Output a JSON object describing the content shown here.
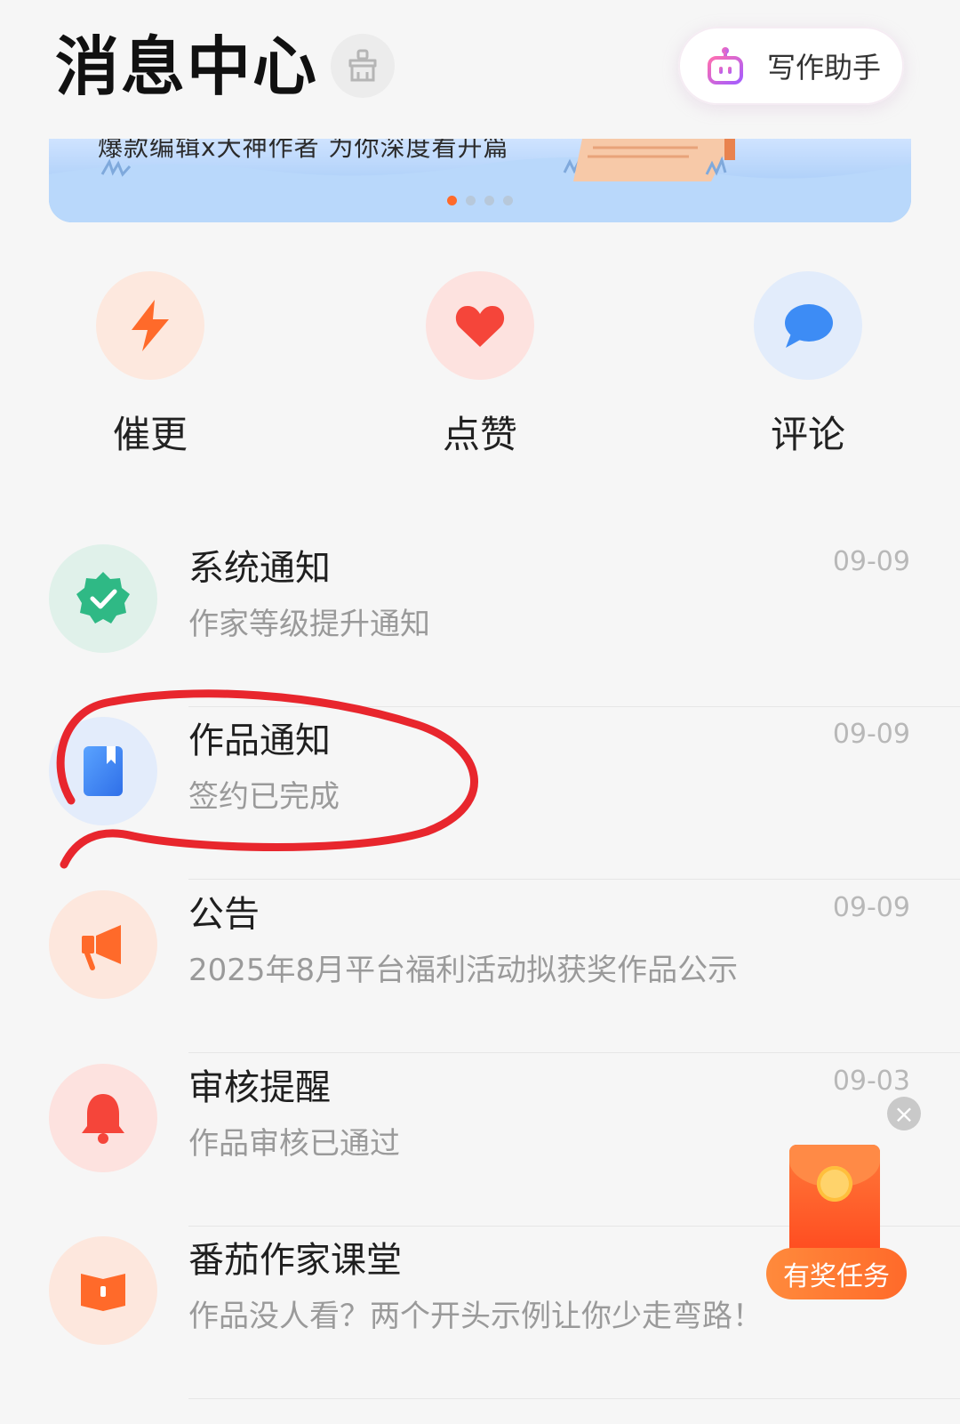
{
  "header": {
    "title": "消息中心",
    "assistant_label": "写作助手"
  },
  "banner": {
    "text": "爆款编辑x大神作者  为你深度看开篇",
    "dots": 4,
    "active_dot": 1
  },
  "quick_actions": [
    {
      "label": "催更",
      "icon": "lightning-icon",
      "bg": "#fde8de",
      "color": "#ff6a2a"
    },
    {
      "label": "点赞",
      "icon": "heart-icon",
      "bg": "#fde2df",
      "color": "#f5453a"
    },
    {
      "label": "评论",
      "icon": "chat-bubble-icon",
      "bg": "#e2ecfb",
      "color": "#3d8cf5"
    }
  ],
  "messages": [
    {
      "name": "系统通知",
      "desc": "作家等级提升通知",
      "date": "09-09",
      "icon": "verified-badge-icon",
      "bg": "#e0f1ea"
    },
    {
      "name": "作品通知",
      "desc": "签约已完成",
      "date": "09-09",
      "icon": "book-icon",
      "bg": "#e3ecfb"
    },
    {
      "name": "公告",
      "desc": "2025年8月平台福利活动拟获奖作品公示",
      "date": "09-09",
      "icon": "megaphone-icon",
      "bg": "#fde7dd"
    },
    {
      "name": "审核提醒",
      "desc": "作品审核已通过",
      "date": "09-03",
      "icon": "bell-icon",
      "bg": "#fde2df"
    },
    {
      "name": "番茄作家课堂",
      "desc": "作品没人看？两个开头示例让你少走弯路！",
      "date": "",
      "icon": "open-book-icon",
      "bg": "#fde7dd"
    }
  ],
  "reward": {
    "label": "有奖任务"
  },
  "colors": {
    "accent": "#ff6a2a",
    "annotation": "#e8262d"
  }
}
